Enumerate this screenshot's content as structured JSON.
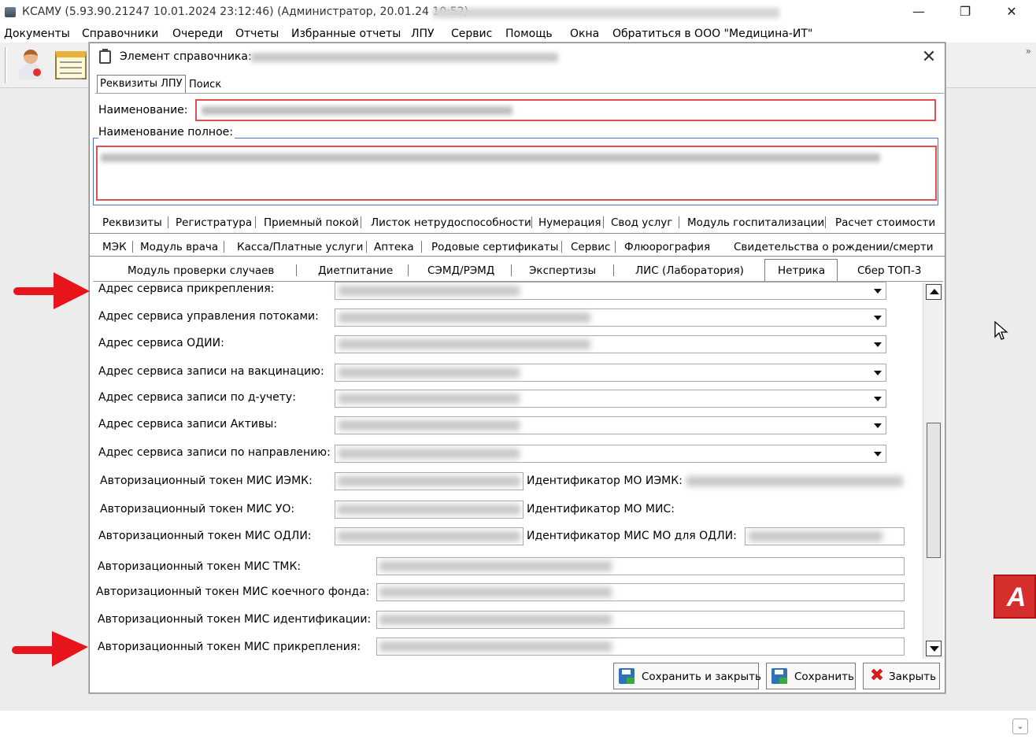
{
  "app": {
    "title": "КСАМУ (5.93.90.21247 10.01.2024 23:12:46) (Администратор, 20.01.24 10:52)",
    "window_controls": {
      "minimize": "—",
      "restore": "❐",
      "close": "✕"
    }
  },
  "menu": [
    "Документы",
    "Справочники",
    "Очереди",
    "Отчеты",
    "Избранные отчеты",
    "ЛПУ",
    "Сервис",
    "Помощь",
    "Окна",
    "Обратиться в ООО \"Медицина-ИТ\""
  ],
  "toolbar": {
    "overflow": "»"
  },
  "dialog": {
    "title": "Элемент справочника:",
    "close_glyph": "✕",
    "top_tabs": [
      "Реквизиты ЛПУ",
      "Поиск"
    ],
    "name_label": "Наименование:",
    "fullname_label": "Наименование полное:",
    "tab_rows": [
      [
        "Реквизиты",
        "Регистратура",
        "Приемный покой",
        "Листок нетрудоспособности",
        "Нумерация",
        "Свод услуг",
        "Модуль госпитализации",
        "Расчет стоимости"
      ],
      [
        "МЭК",
        "Модуль врача",
        "Касса/Платные услуги",
        "Аптека",
        "Родовые сертификаты",
        "Сервис",
        "Флюорография",
        "Свидетельства о рождении/смерти"
      ],
      [
        "Модуль проверки случаев",
        "Диетпитание",
        "СЭМД/РЭМД",
        "Экспертизы",
        "ЛИС (Лаборатория)",
        "Нетрика",
        "Сбер ТОП-3"
      ]
    ],
    "active_tab": "Нетрика",
    "fields": {
      "combo_labels": [
        "Адрес сервиса прикрепления:",
        "Адрес сервиса управления потоками:",
        "Адрес сервиса ОДИИ:",
        "Адрес сервиса записи на вакцинацию:",
        "Адрес сервиса записи по д-учету:",
        "Адрес сервиса записи Активы:",
        "Адрес сервиса записи по направлению:"
      ],
      "token_labels": [
        "Авторизационный токен МИС ИЭМК:",
        "Авторизационный токен МИС УО:",
        "Авторизационный токен МИС ОДЛИ:"
      ],
      "ident_labels": [
        "Идентификатор МО ИЭМК:",
        "Идентификатор МО МИС:",
        "Идентификатор МИС МО для ОДЛИ:"
      ],
      "wide_token_labels": [
        "Авторизационный токен МИС ТМК:",
        "Авторизационный токен МИС коечного фонда:",
        "Авторизационный токен МИС идентификации:",
        "Авторизационный токен МИС прикрепления:"
      ]
    },
    "buttons": {
      "save_close": "Сохранить и закрыть",
      "save": "Сохранить",
      "close": "Закрыть"
    }
  },
  "colors": {
    "annotation_arrow": "#e8141c",
    "required_border": "#e05050"
  },
  "icons": [
    "app-icon",
    "doctor-icon",
    "notepad-icon",
    "document-icon",
    "save-close-icon",
    "save-icon",
    "close-x-icon",
    "cursor-icon"
  ]
}
